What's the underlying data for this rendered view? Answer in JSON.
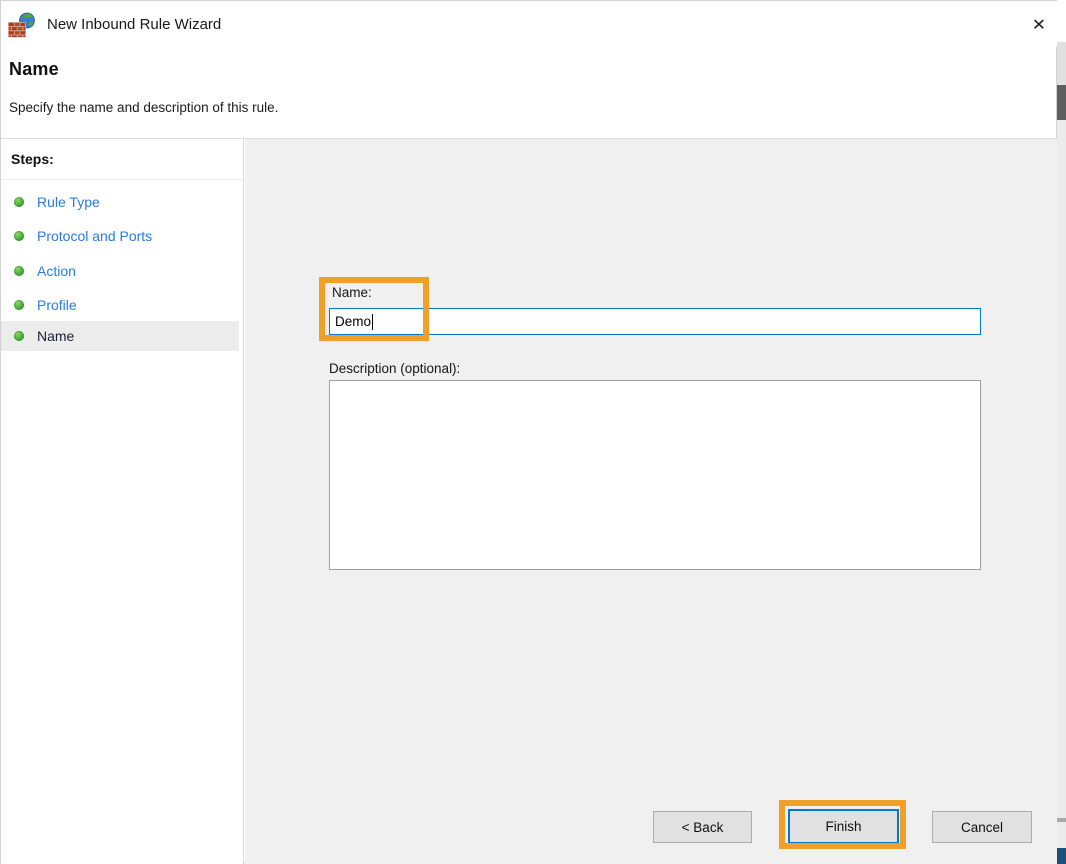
{
  "window": {
    "title": "New Inbound Rule Wizard"
  },
  "icons": {
    "close": "✕",
    "firewall": "brick-wall-with-globe",
    "step_bullet": "green-dot"
  },
  "header": {
    "title": "Name",
    "subtitle": "Specify the name and description of this rule."
  },
  "sidebar": {
    "heading": "Steps:",
    "steps": [
      {
        "label": "Rule Type",
        "active": false
      },
      {
        "label": "Protocol and Ports",
        "active": false
      },
      {
        "label": "Action",
        "active": false
      },
      {
        "label": "Profile",
        "active": false
      },
      {
        "label": "Name",
        "active": true
      }
    ]
  },
  "form": {
    "name_label": "Name:",
    "name_value": "Demo",
    "description_label": "Description (optional):",
    "description_value": ""
  },
  "buttons": {
    "back": "< Back",
    "finish": "Finish",
    "cancel": "Cancel"
  },
  "annotations": {
    "highlight_color": "#F0A028"
  },
  "colors": {
    "focus_blue": "#0078D7",
    "step_link_blue": "#2A7AE2",
    "main_bg": "#F0F0F0",
    "button_bg": "#E1E1E1"
  }
}
